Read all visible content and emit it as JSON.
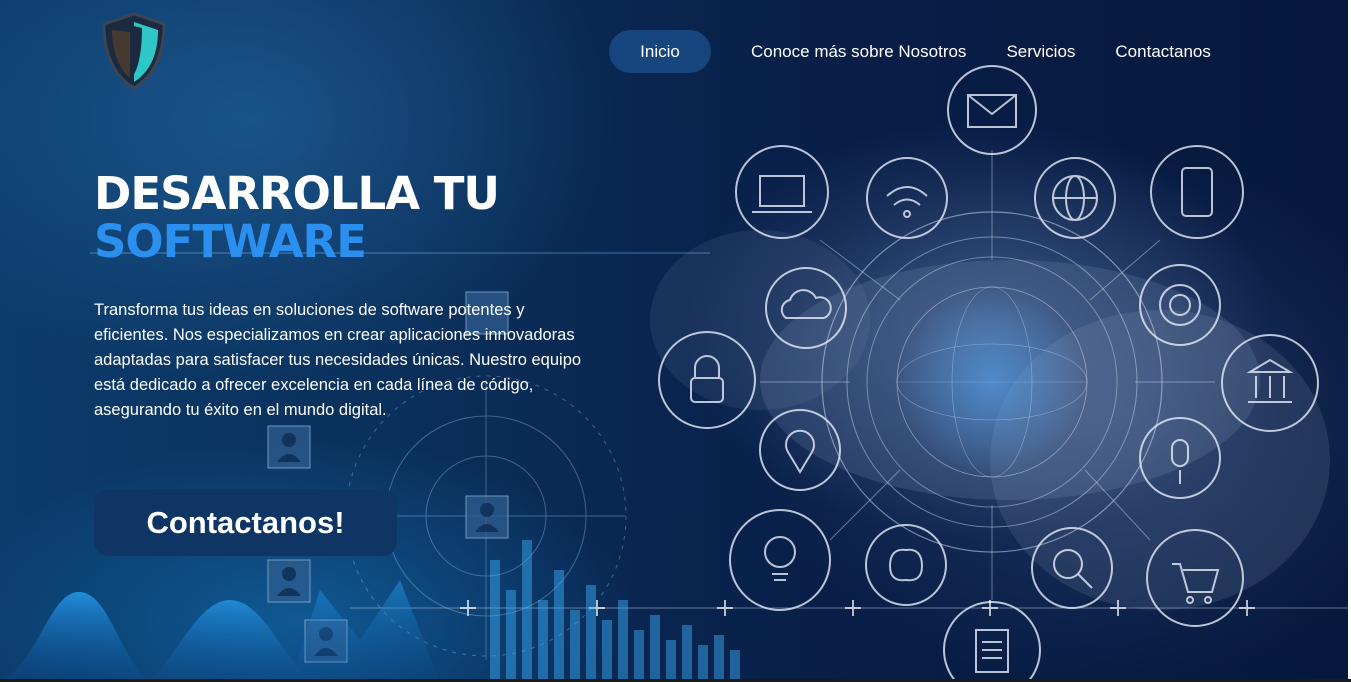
{
  "nav": {
    "items": [
      {
        "label": "Inicio",
        "active": true
      },
      {
        "label": "Conoce más sobre Nosotros",
        "active": false
      },
      {
        "label": "Servicios",
        "active": false
      },
      {
        "label": "Contactanos",
        "active": false
      }
    ]
  },
  "hero": {
    "title_line1": "DESARROLLA TU",
    "title_line2": "SOFTWARE",
    "description": "Transforma tus ideas en soluciones de software potentes y eficientes. Nos especializamos en crear aplicaciones innovadoras adaptadas para satisfacer tus necesidades únicas. Nuestro equipo está dedicado a ofrecer excelencia en cada línea de código, asegurando tu éxito en el mundo digital.",
    "cta_label": "Contactanos!"
  },
  "colors": {
    "accent": "#2b8ff0",
    "nav_active": "#17467e",
    "cta_bg": "#0e3563",
    "logo_teal": "#2fc6c8"
  },
  "icons": [
    "shield-logo-icon",
    "envelope-icon",
    "laptop-icon",
    "wifi-icon",
    "globe-icon",
    "smartphone-icon",
    "cloud-upload-icon",
    "gear-icon",
    "lock-icon",
    "bank-icon",
    "location-pin-icon",
    "microphone-icon",
    "lightbulb-icon",
    "brain-icon",
    "magnifier-chart-icon",
    "shopping-cart-icon",
    "document-icon",
    "person-icon"
  ]
}
